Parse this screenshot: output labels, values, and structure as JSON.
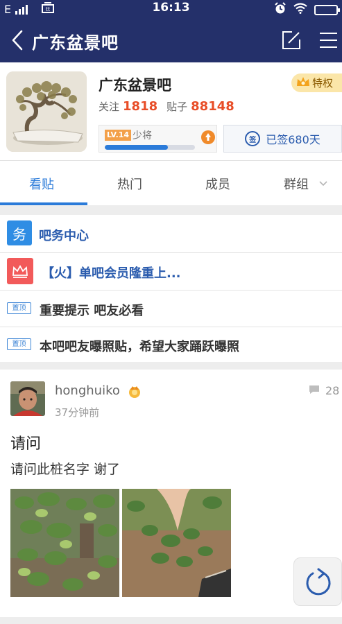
{
  "status_bar": {
    "network": "E",
    "time": "16:13",
    "colors": {
      "background": "#24306a"
    }
  },
  "header": {
    "title": "广东盆景吧",
    "icons": [
      "back-arrow-icon",
      "edit-post-icon",
      "menu-icon"
    ]
  },
  "forum": {
    "name": "广东盆景吧",
    "privilege_label": "特权",
    "follow_label": "关注",
    "follow_count": "1818",
    "posts_label": "贴子",
    "posts_count": "88148",
    "level_badge": "LV.14",
    "level_name": "少将",
    "level_progress_fraction": 0.7,
    "signin_label": "已签680天",
    "signin_icon_text": "签"
  },
  "tabs": [
    {
      "label": "看贴",
      "active": true
    },
    {
      "label": "热门",
      "active": false
    },
    {
      "label": "成员",
      "active": false
    },
    {
      "label": "群组",
      "active": false
    }
  ],
  "top_links": [
    {
      "icon_text": "务",
      "icon_color": "#2f8de4",
      "text": "吧务中心"
    },
    {
      "icon_color": "#f25a5a",
      "text": "【火】单吧会员隆重上..."
    }
  ],
  "sticky_posts": [
    {
      "badge": "置顶",
      "text": "重要提示 吧友必看"
    },
    {
      "badge": "置顶",
      "text": "本吧吧友曝照贴，希望大家踊跃曝照"
    }
  ],
  "post": {
    "username": "honghuiko",
    "time": "37分钟前",
    "comment_count": "28",
    "title": "请问",
    "body": "请问此桩名字 谢了"
  },
  "colors": {
    "accent_blue": "#2b7bd9",
    "stat_orange": "#e84d27",
    "link_blue": "#2b5cae"
  }
}
